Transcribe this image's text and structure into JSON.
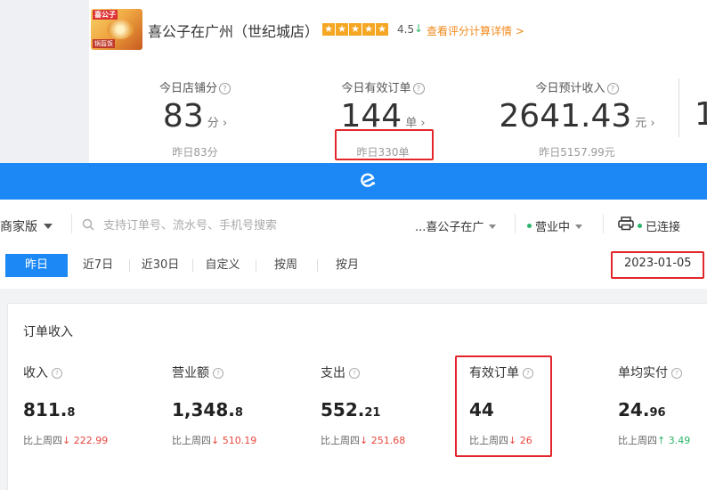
{
  "store": {
    "name": "喜公子在广州（世纪城店）",
    "rating": "4.5",
    "rating_trend": "↓",
    "rating_link": "查看评分计算详情 >",
    "logo_text": "喜公子",
    "logo_sub": "锅盔饭"
  },
  "kpis": [
    {
      "label": "今日店铺分",
      "value": "83",
      "unit": "分 ›",
      "sub": "昨日83分"
    },
    {
      "label": "今日有效订单",
      "value": "144",
      "unit": "单 ›",
      "sub": "昨日330单"
    },
    {
      "label": "今日预计收入",
      "value": "2641.43",
      "unit": "元 ›",
      "sub": "昨日5157.99元"
    }
  ],
  "kpi_clipped_value": "1",
  "toolbar": {
    "merchant_label": "商家版",
    "search_placeholder": "支持订单号、流水号、手机号搜索",
    "store_select": "...喜公子在广",
    "status": "营业中",
    "printer_status": "已连接"
  },
  "date_tabs": [
    "昨日",
    "近7日",
    "近30日",
    "自定义",
    "按周",
    "按月"
  ],
  "active_tab": "昨日",
  "selected_date": "2023-01-05",
  "income": {
    "title": "订单收入",
    "metrics": [
      {
        "label": "收入",
        "int": "811.",
        "dec": "8",
        "cmp_label": "比上周四",
        "arrow": "↓",
        "delta": "222.99",
        "trend": "down"
      },
      {
        "label": "营业额",
        "int": "1,348.",
        "dec": "8",
        "cmp_label": "比上周四",
        "arrow": "↓",
        "delta": "510.19",
        "trend": "down"
      },
      {
        "label": "支出",
        "int": "552.",
        "dec": "21",
        "cmp_label": "比上周四",
        "arrow": "↓",
        "delta": "251.68",
        "trend": "down"
      },
      {
        "label": "有效订单",
        "int": "44",
        "dec": "",
        "cmp_label": "比上周四",
        "arrow": "↓",
        "delta": "26",
        "trend": "down"
      },
      {
        "label": "单均实付",
        "int": "24.",
        "dec": "96",
        "cmp_label": "比上周四",
        "arrow": "↑",
        "delta": "3.49",
        "trend": "up"
      }
    ]
  },
  "colors": {
    "brand_blue": "#1c88f5",
    "highlight_red": "#e3262b",
    "down_red": "#e8473e",
    "up_green": "#2bb56a",
    "link_orange": "#f08a1c"
  }
}
